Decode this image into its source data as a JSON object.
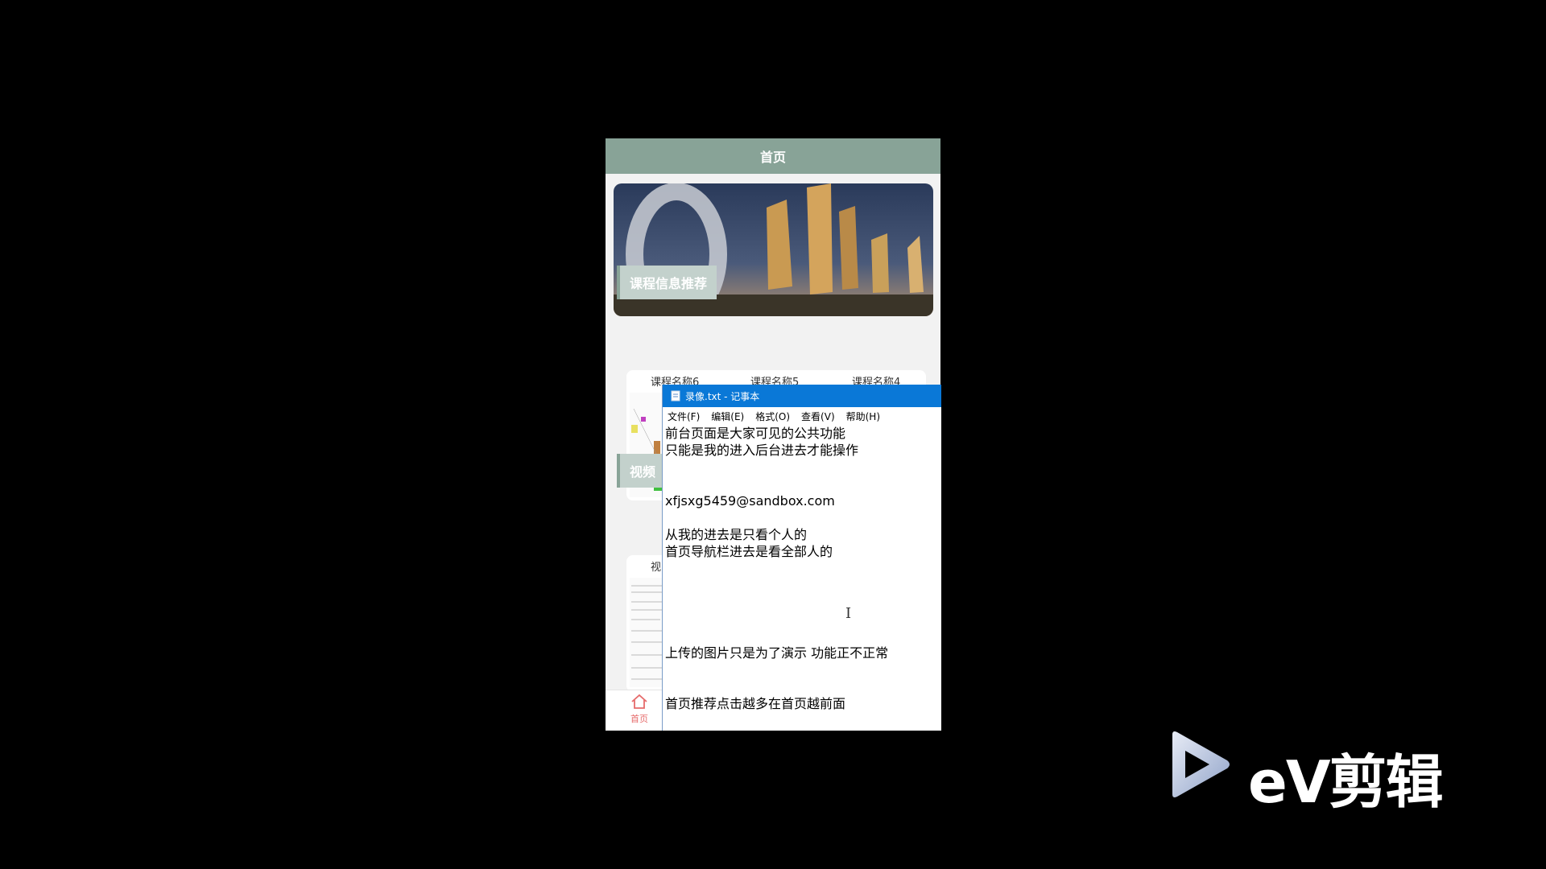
{
  "app": {
    "header_title": "首页",
    "section_course": "课程信息推荐",
    "section_video": "视频",
    "courses": [
      "课程名称6",
      "课程名称5",
      "课程名称4"
    ],
    "video_item": "视",
    "tab_home": "首页"
  },
  "notepad": {
    "title": "录像.txt - 记事本",
    "menus": [
      "文件(F)",
      "编辑(E)",
      "格式(O)",
      "查看(V)",
      "帮助(H)"
    ],
    "lines": [
      "前台页面是大家可见的公共功能",
      "只能是我的进入后台进去才能操作",
      "xfjsxg5459@sandbox.com",
      "从我的进去是只看个人的",
      "首页导航栏进去是看全部人的",
      "上传的图片只是为了演示 功能正不正常",
      "首页推荐点击越多在首页越前面"
    ]
  },
  "watermark": {
    "text": "eV剪辑"
  },
  "colors": {
    "header": "#88a397",
    "notepad_title": "#0a78d7",
    "tab_active": "#e66b6b"
  },
  "icons": [
    "home-icon",
    "notepad-icon",
    "text-cursor-icon",
    "ev-play-icon"
  ]
}
